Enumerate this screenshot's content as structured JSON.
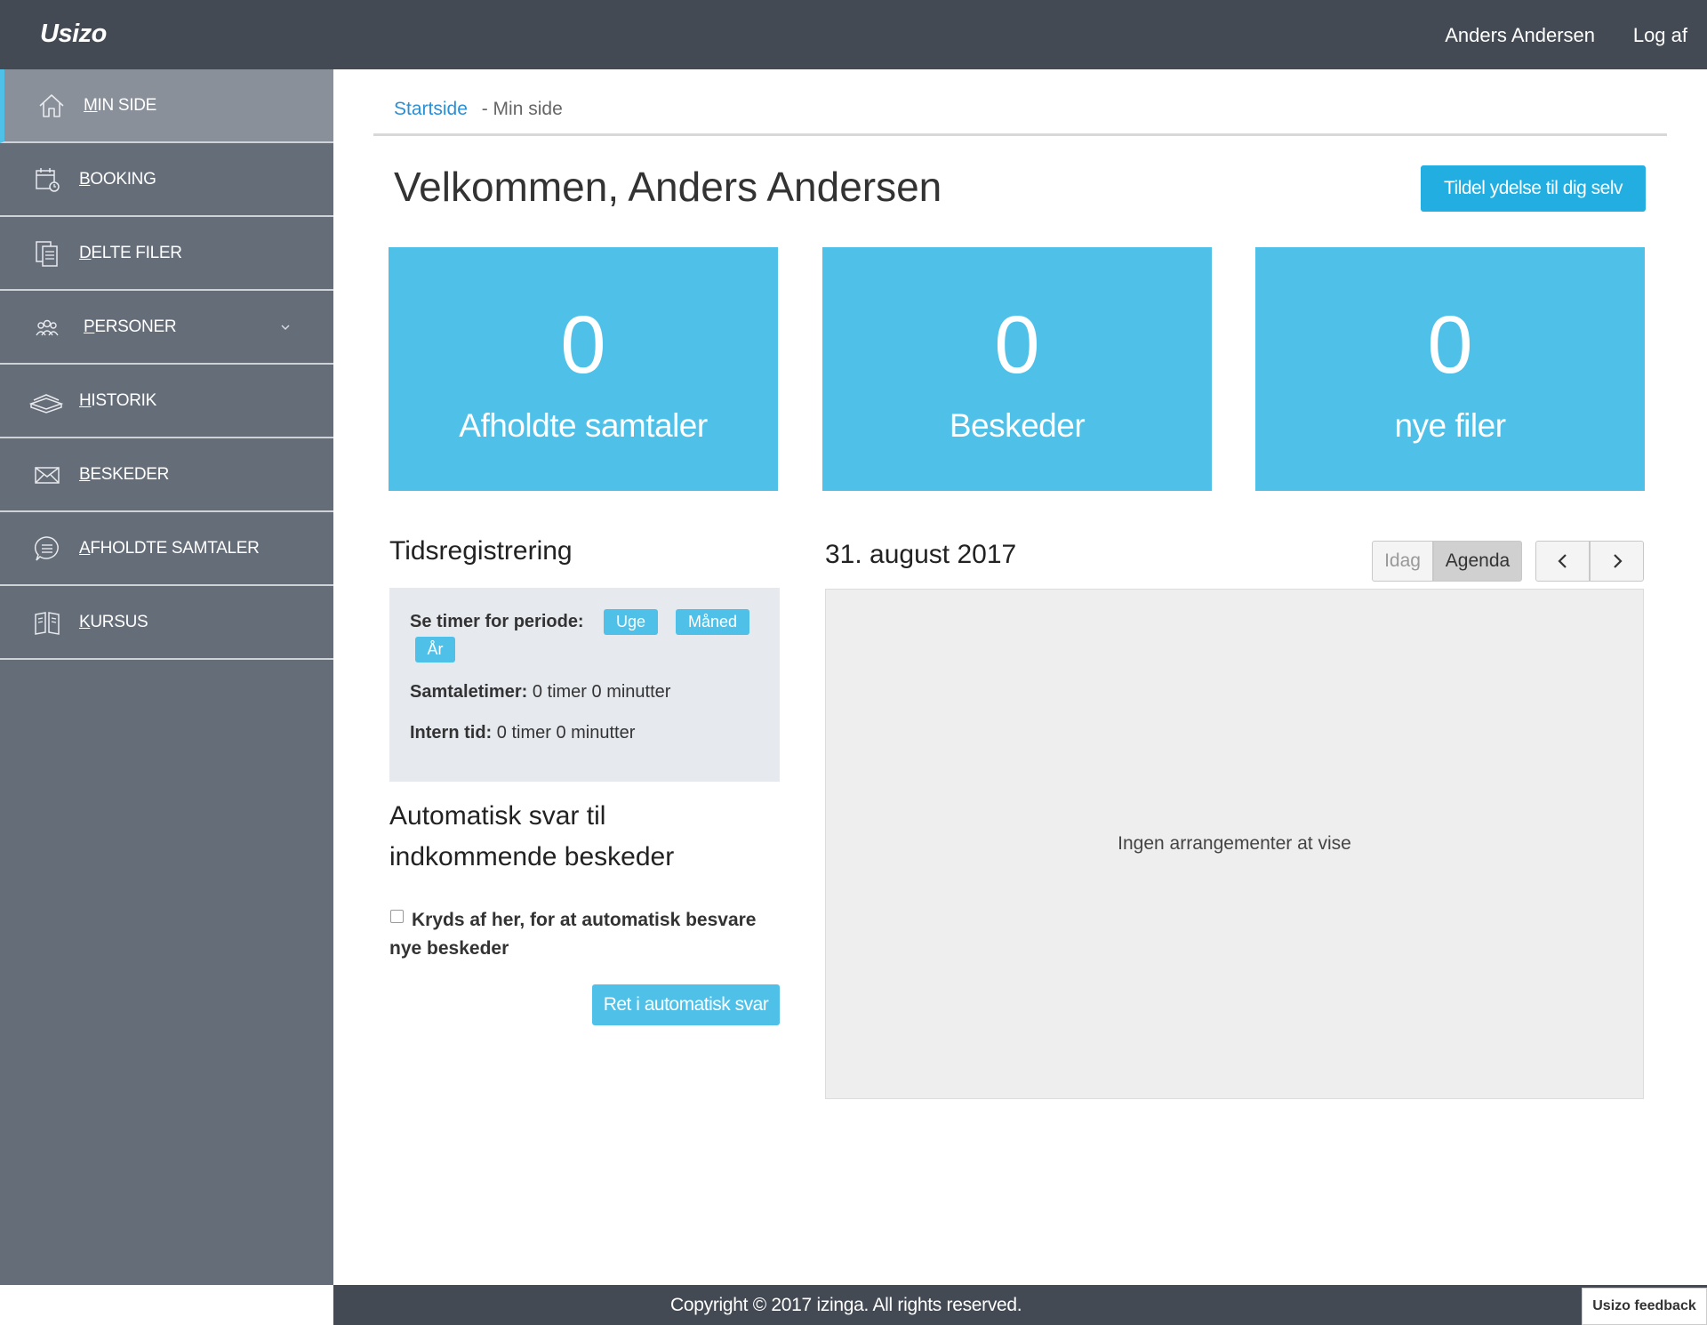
{
  "header": {
    "brand": "Usizo",
    "user": "Anders Andersen",
    "logout": "Log af"
  },
  "sidebar": {
    "items": [
      {
        "first": "M",
        "rest": "IN SIDE",
        "icon": "home-icon",
        "active": true
      },
      {
        "first": "B",
        "rest": "OOKING",
        "icon": "calendar-icon"
      },
      {
        "first": "D",
        "rest": "ELTE FILER",
        "icon": "documents-icon"
      },
      {
        "first": "P",
        "rest": "ERSONER",
        "icon": "people-icon",
        "has_submenu": true
      },
      {
        "first": "H",
        "rest": "ISTORIK",
        "icon": "history-stack-icon"
      },
      {
        "first": "B",
        "rest": "ESKEDER",
        "icon": "envelope-icon"
      },
      {
        "first": "A",
        "rest": "FHOLDTE SAMTALER",
        "icon": "chat-bubble-icon"
      },
      {
        "first": "K",
        "rest": "URSUS",
        "icon": "book-icon"
      }
    ]
  },
  "breadcrumb": {
    "home": "Startside",
    "separator": "- Min side"
  },
  "main": {
    "title": "Velkommen, Anders Andersen",
    "assign_button": "Tildel ydelse til dig selv"
  },
  "stats": [
    {
      "value": "0",
      "label": "Afholdte samtaler"
    },
    {
      "value": "0",
      "label": "Beskeder"
    },
    {
      "value": "0",
      "label": "nye filer"
    }
  ],
  "time_registration": {
    "title": "Tidsregistrering",
    "period_label": "Se timer for periode:",
    "period_options": [
      "Uge",
      "Måned",
      "År"
    ],
    "talk_hours_label": "Samtaletimer:",
    "talk_hours_value": "0 timer 0 minutter",
    "internal_label": "Intern tid:",
    "internal_value": "0 timer 0 minutter"
  },
  "auto_reply": {
    "title": "Automatisk svar til indkommende beskeder",
    "checkbox_label": "Kryds af her, for at automatisk besvare nye beskeder",
    "checked": false,
    "edit_button": "Ret i automatisk svar"
  },
  "calendar": {
    "date": "31. august 2017",
    "today_label": "Idag",
    "agenda_label": "Agenda",
    "empty_text": "Ingen arrangementer at vise"
  },
  "footer": {
    "copyright": "Copyright © 2017 izinga. All rights reserved.",
    "feedback": "Usizo feedback"
  },
  "colors": {
    "topbar": "#434a54",
    "sidebar": "#656d78",
    "accent": "#4fc1e9",
    "button": "#22aee0"
  }
}
